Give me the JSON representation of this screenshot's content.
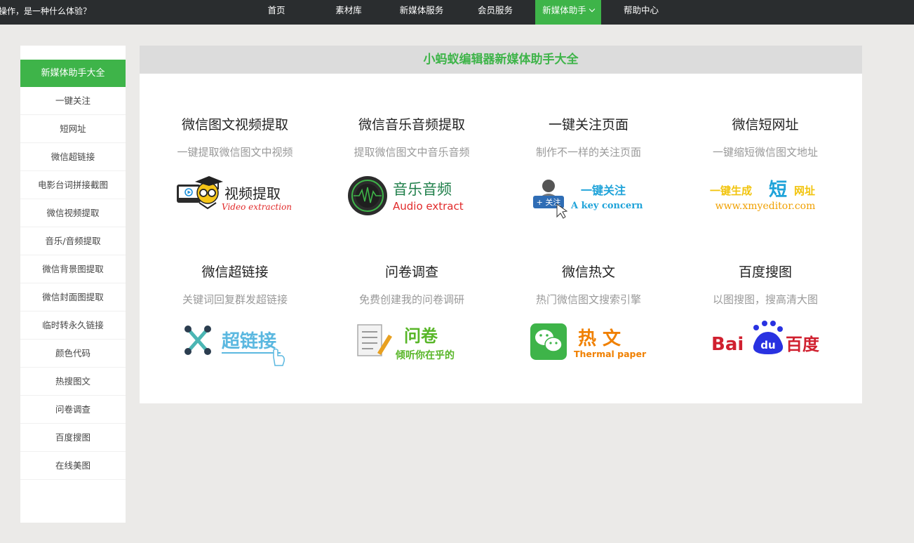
{
  "topbar": {
    "ticker": "操作，是一种什么体验？",
    "nav": [
      {
        "label": "首页"
      },
      {
        "label": "素材库"
      },
      {
        "label": "新媒体服务"
      },
      {
        "label": "会员服务"
      },
      {
        "label": "新媒体助手"
      },
      {
        "label": "帮助中心"
      }
    ]
  },
  "sidebar": {
    "heading": "新媒体助手大全",
    "items": [
      {
        "label": "一键关注"
      },
      {
        "label": "短网址"
      },
      {
        "label": "微信超链接"
      },
      {
        "label": "电影台词拼接截图"
      },
      {
        "label": "微信视频提取"
      },
      {
        "label": "音乐/音频提取"
      },
      {
        "label": "微信背景图提取"
      },
      {
        "label": "微信封面图提取"
      },
      {
        "label": "临时转永久链接"
      },
      {
        "label": "颜色代码"
      },
      {
        "label": "热搜图文"
      },
      {
        "label": "问卷调查"
      },
      {
        "label": "百度搜图"
      },
      {
        "label": "在线美图"
      }
    ]
  },
  "main": {
    "title": "小蚂蚁编辑器新媒体助手大全",
    "tools": [
      {
        "title": "微信图文视频提取",
        "desc": "一键提取微信图文中视频",
        "logo_icon": "video-extraction-logo",
        "logo_text": "视频提取",
        "logo_sub": "Video extraction"
      },
      {
        "title": "微信音乐音频提取",
        "desc": "提取微信图文中音乐音频",
        "logo_icon": "audio-extract-logo",
        "logo_text": "音乐音频",
        "logo_sub": "Audio extract"
      },
      {
        "title": "一键关注页面",
        "desc": "制作不一样的关注页面",
        "logo_icon": "key-concern-logo",
        "logo_text": "一键关注",
        "logo_sub": "A key concern",
        "logo_badge": "+ 关注"
      },
      {
        "title": "微信短网址",
        "desc": "一键缩短微信图文地址",
        "logo_icon": "short-url-logo",
        "logo_text_a": "一键生成",
        "logo_text_b": "短",
        "logo_text_c": "网址",
        "logo_sub": "www.xmyeditor.com"
      },
      {
        "title": "微信超链接",
        "desc": "关键词回复群发超链接",
        "logo_icon": "hyperlink-logo",
        "logo_text": "超链接"
      },
      {
        "title": "问卷调查",
        "desc": "免费创建我的问卷调研",
        "logo_icon": "questionnaire-logo",
        "logo_text": "问卷",
        "logo_sub": "倾听你在乎的"
      },
      {
        "title": "微信热文",
        "desc": "热门微信图文搜索引擎",
        "logo_icon": "hot-article-logo",
        "logo_text": "热 文",
        "logo_sub": "Thermal paper"
      },
      {
        "title": "百度搜图",
        "desc": "以图搜图，搜高清大图",
        "logo_icon": "baidu-logo",
        "logo_text_a": "Bai",
        "logo_text_b": "du",
        "logo_text_c": "百度"
      }
    ]
  },
  "colors": {
    "accent": "#3eb449",
    "topbar": "#2a2d2f",
    "background": "#ebeae8"
  }
}
